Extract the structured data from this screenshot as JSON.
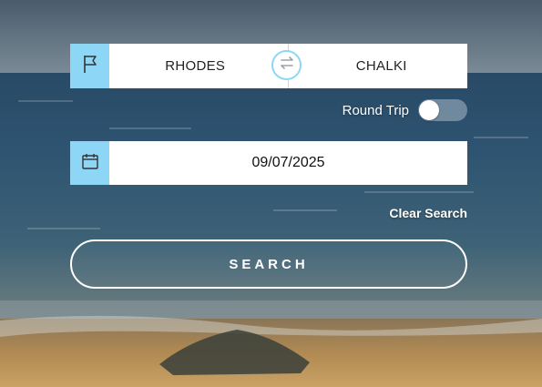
{
  "route": {
    "from": "RHODES",
    "to": "CHALKI",
    "route_icon": "flag-icon",
    "swap_icon": "swap-arrows-icon"
  },
  "round_trip": {
    "label": "Round Trip",
    "enabled": false
  },
  "date": {
    "value": "09/07/2025",
    "icon": "calendar-icon"
  },
  "clear_search_label": "Clear Search",
  "search_label": "SEARCH",
  "colors": {
    "accent": "#8dd6f5",
    "field_bg": "#ffffff",
    "text_light": "#ffffff"
  }
}
